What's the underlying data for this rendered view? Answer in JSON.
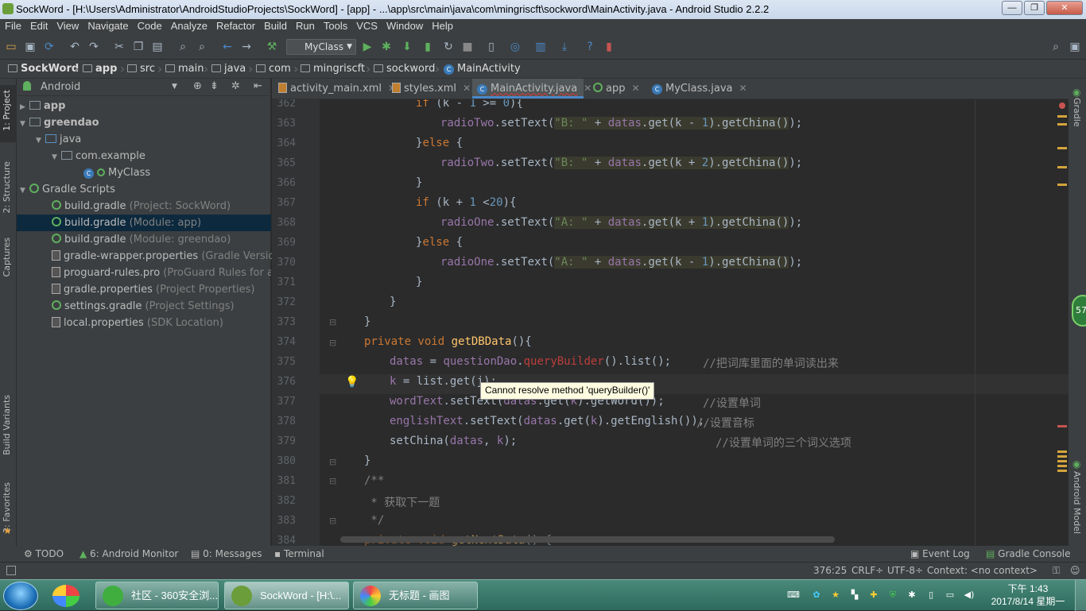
{
  "window": {
    "title": "SockWord - [H:\\Users\\Administrator\\AndroidStudioProjects\\SockWord] - [app] - ...\\app\\src\\main\\java\\com\\mingriscft\\sockword\\MainActivity.java - Android Studio 2.2.2",
    "min": "—",
    "max": "❐",
    "close": "✕"
  },
  "menu": [
    "File",
    "Edit",
    "View",
    "Navigate",
    "Code",
    "Analyze",
    "Refactor",
    "Build",
    "Run",
    "Tools",
    "VCS",
    "Window",
    "Help"
  ],
  "toolbar": {
    "run_config": "MyClass"
  },
  "breadcrumb": [
    "SockWord",
    "app",
    "src",
    "main",
    "java",
    "com",
    "mingriscft",
    "sockword",
    "MainActivity"
  ],
  "project_panel": {
    "view": "Android",
    "tree": [
      {
        "label": "app",
        "hint": ""
      },
      {
        "label": "greendao",
        "hint": ""
      },
      {
        "label": "java",
        "hint": ""
      },
      {
        "label": "com.example",
        "hint": ""
      },
      {
        "label": "MyClass",
        "hint": ""
      },
      {
        "label": "Gradle Scripts",
        "hint": ""
      },
      {
        "label": "build.gradle",
        "hint": "(Project: SockWord)"
      },
      {
        "label": "build.gradle",
        "hint": "(Module: app)"
      },
      {
        "label": "build.gradle",
        "hint": "(Module: greendao)"
      },
      {
        "label": "gradle-wrapper.properties",
        "hint": "(Gradle Version)"
      },
      {
        "label": "proguard-rules.pro",
        "hint": "(ProGuard Rules for app"
      },
      {
        "label": "gradle.properties",
        "hint": "(Project Properties)"
      },
      {
        "label": "settings.gradle",
        "hint": "(Project Settings)"
      },
      {
        "label": "local.properties",
        "hint": "(SDK Location)"
      }
    ]
  },
  "tool_windows_left": [
    "1: Project",
    "2: Structure",
    "Captures",
    "Build Variants",
    "2: Favorites"
  ],
  "tool_windows_right": [
    "Gradle",
    "Android Model"
  ],
  "tabs": [
    "activity_main.xml",
    "styles.xml",
    "MainActivity.java",
    "app",
    "MyClass.java"
  ],
  "editor": {
    "lines": [
      "362",
      "363",
      "364",
      "365",
      "366",
      "367",
      "368",
      "369",
      "370",
      "371",
      "372",
      "373",
      "374",
      "375",
      "376",
      "377",
      "378",
      "379",
      "380",
      "381",
      "382",
      "383",
      "384"
    ],
    "tooltip": "Cannot resolve method 'queryBuilder()'",
    "comments": {
      "c375": "//把词库里面的单词读出来",
      "c377": "//设置单词",
      "c378": "//设置音标",
      "c379": "//设置单词的三个词义选项",
      "c382": " * 获取下一题"
    },
    "badge": "57"
  },
  "bottom_tools": [
    "TODO",
    "6: Android Monitor",
    "0: Messages",
    "Terminal",
    "Event Log",
    "Gradle Console"
  ],
  "status": {
    "position": "376:25",
    "line_sep": "CRLF÷",
    "encoding": "UTF-8÷",
    "context": "Context: <no context>"
  },
  "taskbar": {
    "items": [
      "社区 - 360安全浏...",
      "SockWord - [H:\\...",
      "无标题 - 画图"
    ],
    "time": "下午 1:43",
    "date": "2017/8/14 星期一"
  },
  "colors": {
    "accent": "#4a88c7",
    "keyword": "#cc7832",
    "field": "#9876aa",
    "string": "#6a8759",
    "error": "#bc3f3c",
    "selection": "#0d293e"
  }
}
